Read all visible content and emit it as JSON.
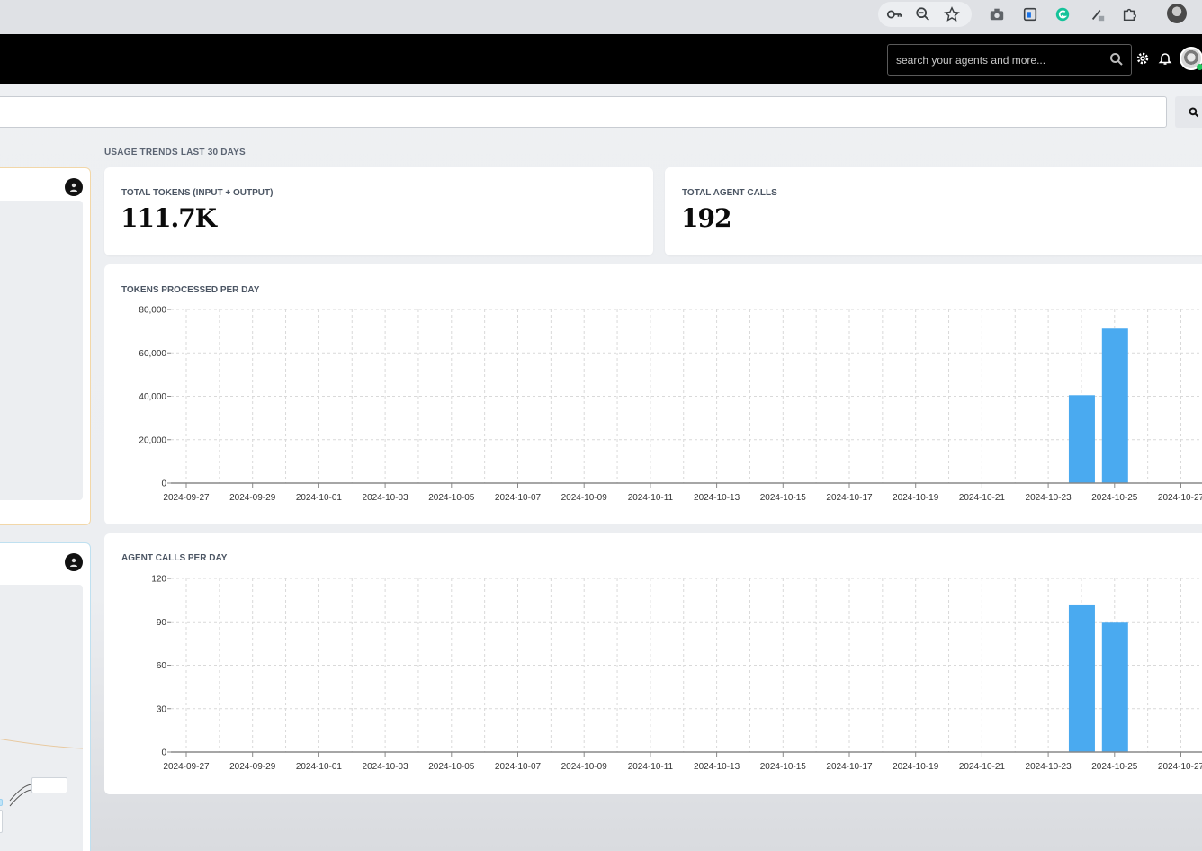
{
  "browser": {
    "icons": [
      "key-icon",
      "zoom-icon",
      "star-icon",
      "camera-icon",
      "extension-icon",
      "grammarly-icon",
      "pen-icon",
      "puzzle-icon"
    ]
  },
  "header": {
    "search_placeholder": "search your agents and more..."
  },
  "main_search": {
    "placeholder": ""
  },
  "usage": {
    "section_title": "USAGE TRENDS LAST 30 DAYS",
    "total_tokens_label": "TOTAL TOKENS (INPUT + OUTPUT)",
    "total_tokens_value": "111.7K",
    "total_calls_label": "TOTAL AGENT CALLS",
    "total_calls_value": "192",
    "tokens_chart_title": "TOKENS PROCESSED PER DAY",
    "calls_chart_title": "AGENT CALLS PER DAY"
  },
  "chart_data": [
    {
      "type": "bar",
      "title": "TOKENS PROCESSED PER DAY",
      "categories": [
        "2024-09-27",
        "2024-09-28",
        "2024-09-29",
        "2024-09-30",
        "2024-10-01",
        "2024-10-02",
        "2024-10-03",
        "2024-10-04",
        "2024-10-05",
        "2024-10-06",
        "2024-10-07",
        "2024-10-08",
        "2024-10-09",
        "2024-10-10",
        "2024-10-11",
        "2024-10-12",
        "2024-10-13",
        "2024-10-14",
        "2024-10-15",
        "2024-10-16",
        "2024-10-17",
        "2024-10-18",
        "2024-10-19",
        "2024-10-20",
        "2024-10-21",
        "2024-10-22",
        "2024-10-23",
        "2024-10-24",
        "2024-10-25",
        "2024-10-26",
        "2024-10-27"
      ],
      "tick_labels": [
        "2024-09-27",
        "2024-09-29",
        "2024-10-01",
        "2024-10-03",
        "2024-10-05",
        "2024-10-07",
        "2024-10-09",
        "2024-10-11",
        "2024-10-13",
        "2024-10-15",
        "2024-10-17",
        "2024-10-19",
        "2024-10-21",
        "2024-10-23",
        "2024-10-25",
        "2024-10-27"
      ],
      "values": [
        0,
        0,
        0,
        0,
        0,
        0,
        0,
        0,
        0,
        0,
        0,
        0,
        0,
        0,
        0,
        0,
        0,
        0,
        0,
        0,
        0,
        0,
        0,
        0,
        0,
        0,
        0,
        40500,
        71200,
        0,
        0
      ],
      "yticks": [
        0,
        20000,
        40000,
        60000,
        80000
      ],
      "ytick_labels": [
        "0",
        "20,000",
        "40,000",
        "60,000",
        "80,000"
      ],
      "ylim": [
        0,
        80000
      ],
      "grid": true,
      "color": "#4aaaf0"
    },
    {
      "type": "bar",
      "title": "AGENT CALLS PER DAY",
      "categories": [
        "2024-09-27",
        "2024-09-28",
        "2024-09-29",
        "2024-09-30",
        "2024-10-01",
        "2024-10-02",
        "2024-10-03",
        "2024-10-04",
        "2024-10-05",
        "2024-10-06",
        "2024-10-07",
        "2024-10-08",
        "2024-10-09",
        "2024-10-10",
        "2024-10-11",
        "2024-10-12",
        "2024-10-13",
        "2024-10-14",
        "2024-10-15",
        "2024-10-16",
        "2024-10-17",
        "2024-10-18",
        "2024-10-19",
        "2024-10-20",
        "2024-10-21",
        "2024-10-22",
        "2024-10-23",
        "2024-10-24",
        "2024-10-25",
        "2024-10-26",
        "2024-10-27"
      ],
      "tick_labels": [
        "2024-09-27",
        "2024-09-29",
        "2024-10-01",
        "2024-10-03",
        "2024-10-05",
        "2024-10-07",
        "2024-10-09",
        "2024-10-11",
        "2024-10-13",
        "2024-10-15",
        "2024-10-17",
        "2024-10-19",
        "2024-10-21",
        "2024-10-23",
        "2024-10-25",
        "2024-10-27"
      ],
      "values": [
        0,
        0,
        0,
        0,
        0,
        0,
        0,
        0,
        0,
        0,
        0,
        0,
        0,
        0,
        0,
        0,
        0,
        0,
        0,
        0,
        0,
        0,
        0,
        0,
        0,
        0,
        0,
        102,
        90,
        0,
        0
      ],
      "yticks": [
        0,
        30,
        60,
        90,
        120
      ],
      "ytick_labels": [
        "0",
        "30",
        "60",
        "90",
        "120"
      ],
      "ylim": [
        0,
        120
      ],
      "grid": true,
      "color": "#4aaaf0"
    }
  ]
}
